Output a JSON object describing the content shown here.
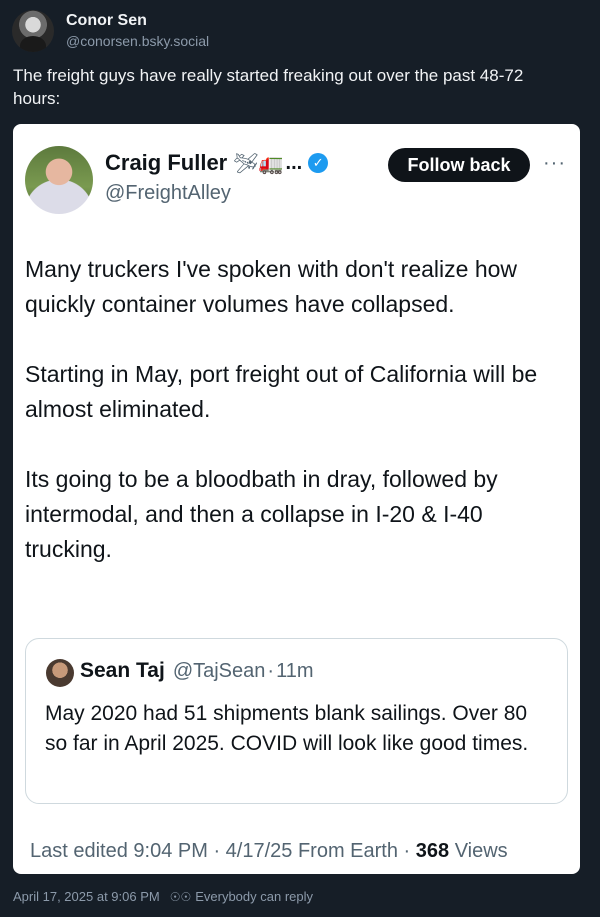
{
  "post": {
    "author_name": "Conor Sen",
    "author_handle": "@conorsen.bsky.social",
    "text": "The freight guys have really started freaking out over the past 48-72 hours:",
    "timestamp": "April 17, 2025 at 9:06 PM",
    "reply_setting": "Everybody can reply"
  },
  "embed": {
    "name": "Craig Fuller",
    "name_emoji": "🛩🚛",
    "name_ellipsis": "...",
    "verified_icon": "✓",
    "handle": "@FreightAlley",
    "follow_label": "Follow back",
    "more_label": "···",
    "paragraphs": [
      "Many truckers I've spoken with don't realize how quickly container volumes have collapsed.",
      "Starting in May, port freight out of California will be almost eliminated.",
      "Its going to be a bloodbath in dray, followed by intermodal, and then a collapse in I-20 & I-40 trucking."
    ],
    "quote": {
      "name": "Sean Taj",
      "handle": "@TajSean",
      "dot": "·",
      "time": "11m",
      "text": "May 2020 had 51 shipments blank sailings. Over 80 so far in April 2025. COVID will look like good times."
    },
    "meta": {
      "edited": "Last edited 9:04 PM",
      "sep1": " · ",
      "date": "4/17/25",
      "source": " From Earth",
      "sep2": " · ",
      "views_count": "368",
      "views_label": " Views"
    }
  }
}
